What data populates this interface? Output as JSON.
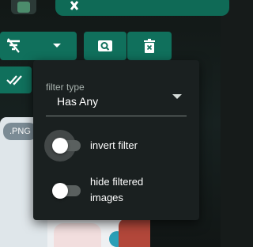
{
  "toolbar": {
    "filter_button": {
      "icon": "filter-off-icon",
      "dropdown_icon": "caret-down-icon"
    },
    "search_button": {
      "icon": "image-search-icon"
    },
    "delete_button": {
      "icon": "delete-icon"
    },
    "select_all_button": {
      "icon": "double-check-icon"
    },
    "accent": "#10705c"
  },
  "background_card": {
    "badge": ".PNG"
  },
  "filter_popup": {
    "field_label": "filter type",
    "selected_value": "Has Any",
    "options": [
      {
        "label": "invert filter",
        "on": false
      },
      {
        "label": "hide filtered images",
        "on": false
      }
    ],
    "background": "#1a2020"
  }
}
